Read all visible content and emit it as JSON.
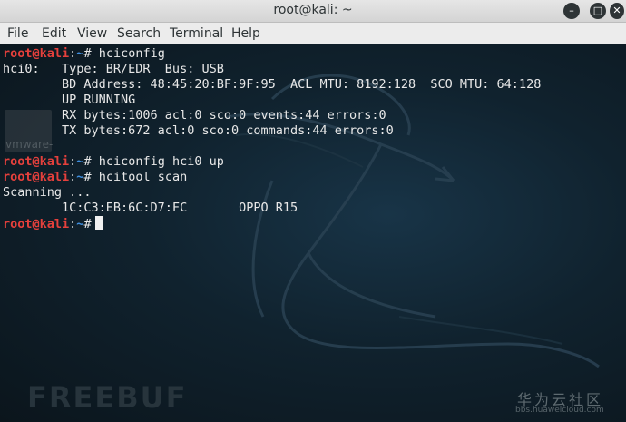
{
  "window": {
    "title": "root@kali: ~",
    "minimize_icon": "minimize-icon",
    "maximize_icon": "maximize-icon",
    "close_icon": "close-icon"
  },
  "menu": [
    "File",
    "Edit",
    "View",
    "Search",
    "Terminal",
    "Help"
  ],
  "prompt": {
    "user_host": "root@kali",
    "colon": ":",
    "path": "~",
    "sign": "#"
  },
  "lines": [
    {
      "type": "prompt",
      "cmd": " hciconfig"
    },
    {
      "type": "out",
      "text": "hci0:   Type: BR/EDR  Bus: USB"
    },
    {
      "type": "out",
      "text": "        BD Address: 48:45:20:BF:9F:95  ACL MTU: 8192:128  SCO MTU: 64:128"
    },
    {
      "type": "out",
      "text": "        UP RUNNING"
    },
    {
      "type": "out",
      "text": "        RX bytes:1006 acl:0 sco:0 events:44 errors:0"
    },
    {
      "type": "out",
      "text": "        TX bytes:672 acl:0 sco:0 commands:44 errors:0"
    },
    {
      "type": "blank",
      "text": ""
    },
    {
      "type": "prompt",
      "cmd": " hciconfig hci0 up"
    },
    {
      "type": "prompt",
      "cmd": " hcitool scan"
    },
    {
      "type": "out",
      "text": "Scanning ..."
    },
    {
      "type": "out",
      "text": "        1C:C3:EB:6C:D7:FC       OPPO R15"
    },
    {
      "type": "prompt",
      "cmd": ""
    }
  ],
  "desktop_label": "vmware-",
  "watermarks": {
    "brand": "FREEBUF",
    "cn": "华为云社区",
    "url": "bbs.huaweicloud.com"
  },
  "colors": {
    "prompt_user": "#e5403c",
    "prompt_path": "#3f8fe0",
    "text": "#e8e8e8",
    "background": "#10222e"
  }
}
